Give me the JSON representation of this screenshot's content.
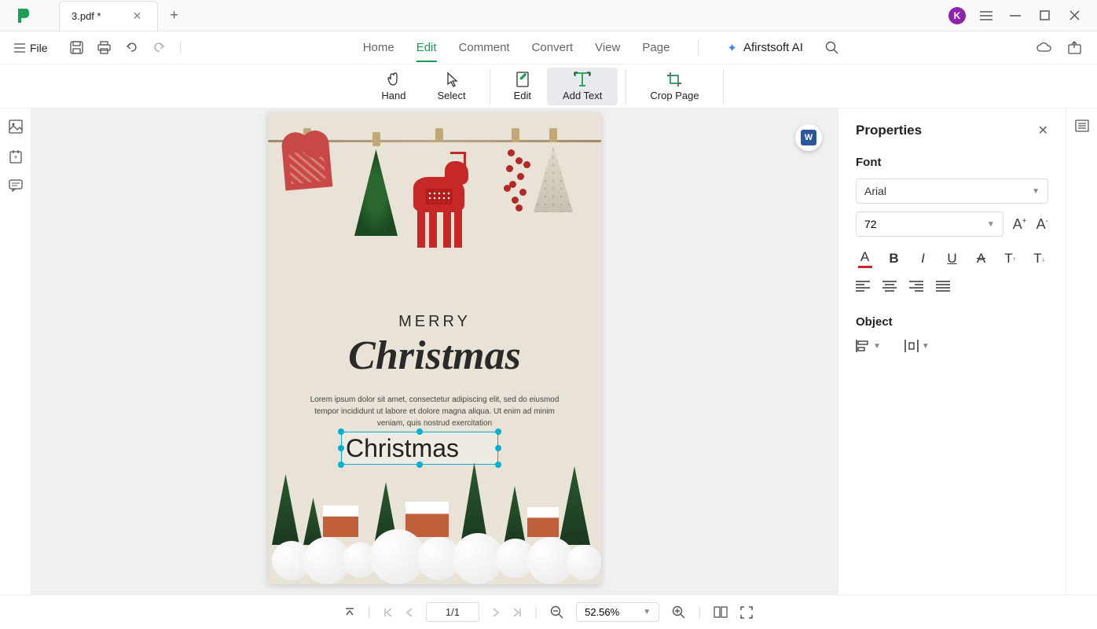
{
  "titlebar": {
    "tab_name": "3.pdf *",
    "user_initial": "K"
  },
  "menubar": {
    "file": "File",
    "items": [
      "Home",
      "Edit",
      "Comment",
      "Convert",
      "View",
      "Page"
    ],
    "active_index": 1,
    "ai": "Afirstsoft AI"
  },
  "toolbar": {
    "hand": "Hand",
    "select": "Select",
    "edit": "Edit",
    "add_text": "Add Text",
    "crop_page": "Crop Page"
  },
  "document": {
    "merry": "MERRY",
    "christmas": "Christmas",
    "lorem": "Lorem ipsum dolor sit amet, consectetur adipiscing elit, sed do eiusmod tempor incididunt ut labore et dolore magna aliqua. Ut enim ad minim veniam, quis nostrud exercitation",
    "textbox_value": "Christmas",
    "word_badge": "W"
  },
  "properties": {
    "title": "Properties",
    "font_section": "Font",
    "font_family": "Arial",
    "font_size": "72",
    "object_section": "Object"
  },
  "statusbar": {
    "page": "1/1",
    "zoom": "52.56%"
  }
}
